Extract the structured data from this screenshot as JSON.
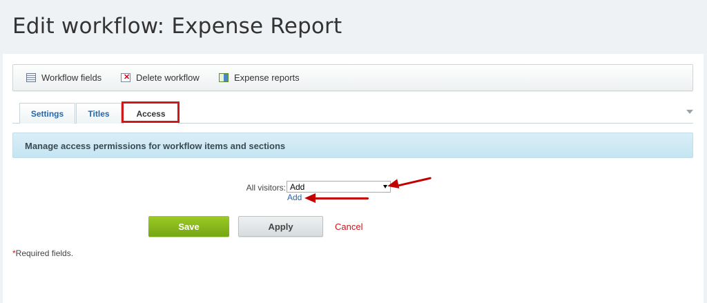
{
  "page": {
    "title": "Edit workflow: Expense Report"
  },
  "toolbar": {
    "items": [
      {
        "label": "Workflow fields",
        "icon": "table-icon"
      },
      {
        "label": "Delete workflow",
        "icon": "delete-icon"
      },
      {
        "label": "Expense reports",
        "icon": "reports-icon"
      }
    ]
  },
  "tabs": [
    {
      "label": "Settings",
      "active": false
    },
    {
      "label": "Titles",
      "active": false
    },
    {
      "label": "Access",
      "active": true
    }
  ],
  "info": {
    "text": "Manage access permissions for workflow items and sections"
  },
  "permissions": {
    "label": "All visitors:",
    "selected": "Add",
    "add_link": "Add"
  },
  "buttons": {
    "save": "Save",
    "apply": "Apply",
    "cancel": "Cancel"
  },
  "footer": {
    "required_star": "*",
    "required_text": "Required fields."
  },
  "colors": {
    "highlight": "#d11818",
    "save_green": "#8bbd1d",
    "link_blue": "#2067b0",
    "cancel_red": "#d0121b"
  }
}
